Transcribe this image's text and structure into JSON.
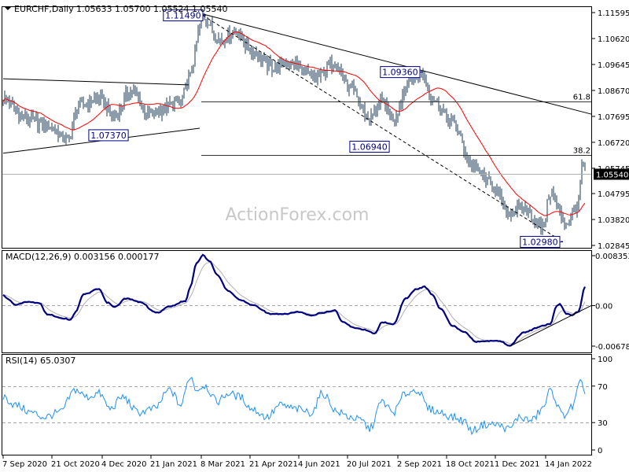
{
  "header": {
    "symbol_label": "EURCHF,Daily",
    "ohlc": "1.05633 1.05700 1.05524 1.05540"
  },
  "watermark": "ActionForex.com",
  "colors": {
    "bars": "#1b3a57",
    "ma": "#ff0000",
    "macd": "#000080",
    "signal": "#b0b0b0",
    "label_border": "#00008b"
  },
  "chart_data": [
    {
      "type": "line",
      "title": "EURCHF,Daily",
      "bars_total": 371,
      "ylim": [
        1.02845,
        1.11595
      ],
      "yticks": [
        "1.11595",
        "1.10620",
        "1.09645",
        "1.08670",
        "1.07695",
        "1.06720",
        "1.05745",
        "1.04795",
        "1.03820",
        "1.02845"
      ],
      "current_price": "1.05540",
      "price_anchors": [
        [
          0,
          1.0837
        ],
        [
          13,
          1.0764
        ],
        [
          28,
          1.0734
        ],
        [
          41,
          1.0681
        ],
        [
          48,
          1.0808
        ],
        [
          61,
          1.0837
        ],
        [
          71,
          1.0769
        ],
        [
          81,
          1.0867
        ],
        [
          93,
          1.0778
        ],
        [
          113,
          1.0823
        ],
        [
          118,
          1.0911
        ],
        [
          127,
          1.1142
        ],
        [
          138,
          1.1059
        ],
        [
          148,
          1.1088
        ],
        [
          158,
          1.1015
        ],
        [
          171,
          1.0955
        ],
        [
          183,
          1.097
        ],
        [
          198,
          1.0911
        ],
        [
          211,
          1.097
        ],
        [
          221,
          1.0867
        ],
        [
          233,
          1.0764
        ],
        [
          241,
          1.0823
        ],
        [
          248,
          1.0764
        ],
        [
          258,
          1.0897
        ],
        [
          267,
          1.0926
        ],
        [
          273,
          1.0837
        ],
        [
          286,
          1.0748
        ],
        [
          298,
          1.0586
        ],
        [
          311,
          1.0512
        ],
        [
          321,
          1.0409
        ],
        [
          331,
          1.0424
        ],
        [
          343,
          1.035
        ],
        [
          348,
          1.0483
        ],
        [
          358,
          1.0365
        ],
        [
          366,
          1.0439
        ],
        [
          368,
          1.0586
        ],
        [
          370,
          1.0554
        ]
      ],
      "ma_period": 25,
      "annotations": [
        {
          "text": "1.11490",
          "bar": 127,
          "price": 1.1149,
          "side": "left"
        },
        {
          "text": "1.07370",
          "bar": 67,
          "price": 1.0737,
          "side": "center-below"
        },
        {
          "text": "1.06940",
          "bar": 233,
          "price": 1.0694,
          "side": "center-below"
        },
        {
          "text": "1.09360",
          "bar": 265,
          "price": 1.0936,
          "side": "left"
        },
        {
          "text": "1.02980",
          "bar": 354,
          "price": 1.0298,
          "side": "left"
        }
      ],
      "fib_levels": [
        {
          "label": "61.8",
          "price": 1.0824,
          "from_bar": 126
        },
        {
          "label": "38.2",
          "price": 1.0623,
          "from_bar": 126
        }
      ],
      "trendlines": [
        {
          "from": [
            127,
            1.1154
          ],
          "to": [
            375,
            1.0778
          ],
          "dashed": false
        },
        {
          "from": [
            127,
            1.1149
          ],
          "to": [
            356,
            1.0298
          ],
          "dashed": true
        },
        {
          "from": [
            0,
            1.0911
          ],
          "to": [
            118,
            1.0888
          ],
          "dashed": false
        },
        {
          "from": [
            0,
            1.0631
          ],
          "to": [
            125,
            1.0725
          ],
          "dashed": false
        }
      ],
      "xticks": [
        {
          "bar": 0,
          "label": "7 Sep 2020"
        },
        {
          "bar": 31,
          "label": "21 Oct 2020"
        },
        {
          "bar": 63,
          "label": "4 Dec 2020"
        },
        {
          "bar": 94,
          "label": "21 Jan 2021"
        },
        {
          "bar": 126,
          "label": "8 Mar 2021"
        },
        {
          "bar": 157,
          "label": "21 Apr 2021"
        },
        {
          "bar": 188,
          "label": "4 Jun 2021"
        },
        {
          "bar": 219,
          "label": "20 Jul 2021"
        },
        {
          "bar": 251,
          "label": "2 Sep 2021"
        },
        {
          "bar": 282,
          "label": "18 Oct 2021"
        },
        {
          "bar": 313,
          "label": "1 Dec 2021"
        },
        {
          "bar": 345,
          "label": "14 Jan 2022"
        }
      ]
    },
    {
      "type": "line",
      "title": "MACD(12,26,9) 0.003156 0.000177",
      "ylim": [
        -0.006788,
        0.008353
      ],
      "yticks": [
        "0.008353",
        "0.00",
        "-0.006788"
      ],
      "signal_period": 9,
      "macd_anchors": [
        [
          0,
          0.00184
        ],
        [
          3,
          0.00105
        ],
        [
          8,
          0.00013
        ],
        [
          16,
          0.00066
        ],
        [
          23,
          0.0004
        ],
        [
          28,
          -0.00145
        ],
        [
          38,
          -0.00211
        ],
        [
          43,
          -0.00237
        ],
        [
          46,
          -0.00105
        ],
        [
          51,
          0.00184
        ],
        [
          61,
          0.00277
        ],
        [
          66,
          0.00053
        ],
        [
          71,
          -0.00026
        ],
        [
          78,
          0.00119
        ],
        [
          88,
          0.00053
        ],
        [
          96,
          -0.00105
        ],
        [
          98,
          -0.00119
        ],
        [
          106,
          -0.00013
        ],
        [
          116,
          0.00079
        ],
        [
          119,
          0.00316
        ],
        [
          123,
          0.00711
        ],
        [
          127,
          0.00843
        ],
        [
          131,
          0.00751
        ],
        [
          136,
          0.00514
        ],
        [
          143,
          0.0025
        ],
        [
          151,
          0.00092
        ],
        [
          158,
          0.00013
        ],
        [
          171,
          -0.00145
        ],
        [
          178,
          -0.00145
        ],
        [
          188,
          -0.00105
        ],
        [
          196,
          -0.00171
        ],
        [
          203,
          -0.00119
        ],
        [
          211,
          -0.00079
        ],
        [
          216,
          -0.00277
        ],
        [
          223,
          -0.00369
        ],
        [
          231,
          -0.00408
        ],
        [
          236,
          -0.00474
        ],
        [
          241,
          -0.00277
        ],
        [
          248,
          -0.00316
        ],
        [
          256,
          0.00119
        ],
        [
          263,
          0.00277
        ],
        [
          268,
          0.00316
        ],
        [
          273,
          0.00184
        ],
        [
          278,
          -0.00053
        ],
        [
          286,
          -0.00342
        ],
        [
          293,
          -0.00435
        ],
        [
          301,
          -0.00606
        ],
        [
          308,
          -0.00593
        ],
        [
          316,
          -0.00593
        ],
        [
          322,
          -0.00672
        ],
        [
          331,
          -0.00448
        ],
        [
          343,
          -0.00342
        ],
        [
          348,
          -0.00303
        ],
        [
          352,
          0
        ],
        [
          354,
          0.00026
        ],
        [
          358,
          -0.00132
        ],
        [
          362,
          -0.00158
        ],
        [
          366,
          -0.00092
        ],
        [
          370,
          0.00316
        ]
      ],
      "trendline": {
        "from": [
          322,
          -0.00685
        ],
        "to": [
          374,
          0.0
        ]
      }
    },
    {
      "type": "line",
      "title": "RSI(14) 65.0307",
      "ylim": [
        0,
        100
      ],
      "yticks": [
        "100",
        "70",
        "30",
        "0"
      ],
      "levels": [
        70,
        30
      ],
      "rsi_anchors": [
        [
          0,
          58
        ],
        [
          8,
          49
        ],
        [
          18,
          41
        ],
        [
          26,
          36
        ],
        [
          36,
          41
        ],
        [
          46,
          66
        ],
        [
          53,
          58
        ],
        [
          61,
          62
        ],
        [
          68,
          45
        ],
        [
          76,
          58
        ],
        [
          86,
          41
        ],
        [
          96,
          45
        ],
        [
          106,
          66
        ],
        [
          113,
          49
        ],
        [
          119,
          81
        ],
        [
          123,
          66
        ],
        [
          128,
          71
        ],
        [
          136,
          53
        ],
        [
          143,
          62
        ],
        [
          151,
          58
        ],
        [
          158,
          45
        ],
        [
          168,
          36
        ],
        [
          176,
          49
        ],
        [
          186,
          45
        ],
        [
          196,
          41
        ],
        [
          203,
          62
        ],
        [
          213,
          41
        ],
        [
          221,
          36
        ],
        [
          228,
          32
        ],
        [
          233,
          23
        ],
        [
          241,
          53
        ],
        [
          248,
          41
        ],
        [
          256,
          62
        ],
        [
          263,
          66
        ],
        [
          271,
          45
        ],
        [
          278,
          41
        ],
        [
          286,
          36
        ],
        [
          293,
          32
        ],
        [
          298,
          21
        ],
        [
          306,
          28
        ],
        [
          313,
          28
        ],
        [
          322,
          23
        ],
        [
          328,
          36
        ],
        [
          336,
          32
        ],
        [
          343,
          45
        ],
        [
          348,
          65
        ],
        [
          356,
          38
        ],
        [
          362,
          47
        ],
        [
          367,
          73
        ],
        [
          370,
          65
        ]
      ]
    }
  ]
}
